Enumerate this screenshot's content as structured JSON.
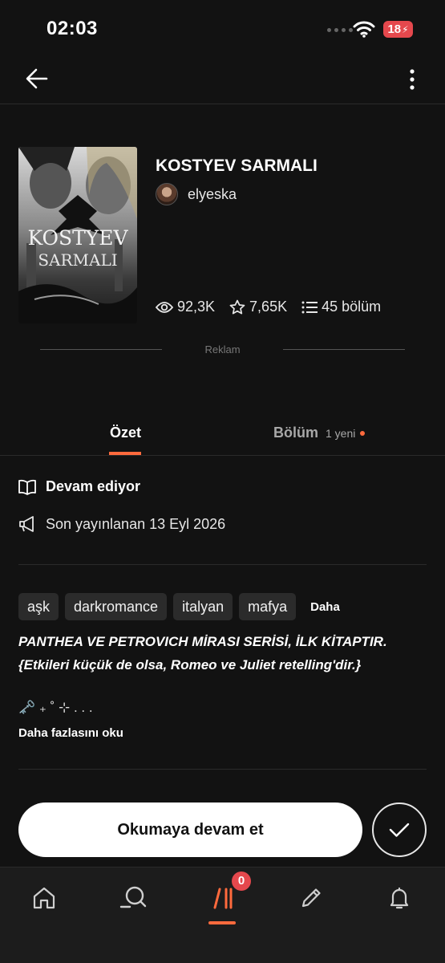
{
  "status_bar": {
    "time": "02:03",
    "battery": "18"
  },
  "book": {
    "title": "KOSTYEV SARMALI",
    "author": "elyeska",
    "cover_title_top": "KOSTYEV",
    "cover_title_bottom": "SARMALI",
    "reads": "92,3K",
    "votes": "7,65K",
    "parts": "45 bölüm"
  },
  "ad": {
    "label": "Reklam"
  },
  "tabs": [
    {
      "label": "Özet",
      "active": true
    },
    {
      "label": "Bölüm",
      "note": "1 yeni",
      "active": false
    }
  ],
  "info": {
    "status": "Devam ediyor",
    "published": "Son yayınlanan 13 Eyl 2026"
  },
  "tags": [
    "aşk",
    "darkromance",
    "italyan",
    "mafya"
  ],
  "tags_more": "Daha",
  "description": {
    "line1": "PANTHEA VE PETROVICH MİRASI SERİSİ, İLK KİTAPTIR.",
    "line2": "{Etkileri küçük de olsa, Romeo ve Juliet retelling'dir.}",
    "emoji_line": "🗝️˚₊‧꒰ა ✧‧₊˚",
    "emoji_text": "🗝️ ₊ ˚ ⊹ . . ."
  },
  "read_more": "Daha fazlasını oku",
  "continue_button": "Okumaya devam et",
  "bottom_nav": {
    "items": [
      "home-icon",
      "search-icon",
      "library-icon",
      "write-icon",
      "notifications-icon"
    ],
    "library_badge": "0"
  },
  "colors": {
    "background": "#121212",
    "accent": "#ff6a3d",
    "badge": "#e5484d",
    "tag_bg": "#2b2b2b"
  }
}
